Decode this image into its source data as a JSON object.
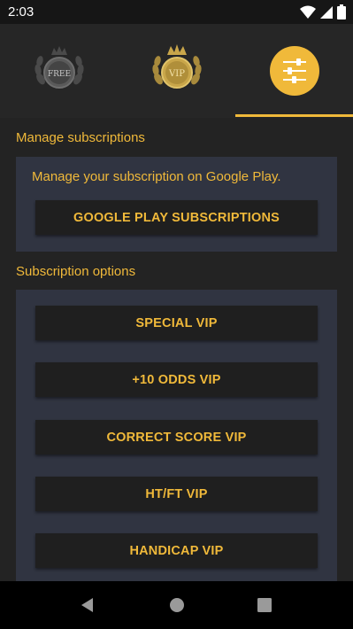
{
  "status_bar": {
    "time": "2:03",
    "icons": [
      "wifi-icon",
      "signal-icon",
      "battery-icon"
    ]
  },
  "tabs": [
    {
      "name": "free",
      "badge_text": "FREE",
      "selected": false
    },
    {
      "name": "vip",
      "badge_text": "VIP",
      "selected": false
    },
    {
      "name": "settings",
      "icon": "sliders-icon",
      "selected": true
    }
  ],
  "manage_section": {
    "title": "Manage subscriptions",
    "description": "Manage your subscription on Google Play.",
    "button_label": "GOOGLE PLAY SUBSCRIPTIONS"
  },
  "options_section": {
    "title": "Subscription options",
    "buttons": [
      {
        "label": "SPECIAL VIP"
      },
      {
        "label": "+10 ODDS VIP"
      },
      {
        "label": "CORRECT SCORE VIP"
      },
      {
        "label": "HT/FT VIP"
      },
      {
        "label": "HANDICAP VIP"
      }
    ]
  },
  "nav_bar": {
    "buttons": [
      "back-icon",
      "home-icon",
      "recents-icon"
    ]
  },
  "colors": {
    "accent": "#f0b93a",
    "card": "#303441",
    "background": "#232323",
    "button": "#1f1f1f"
  }
}
